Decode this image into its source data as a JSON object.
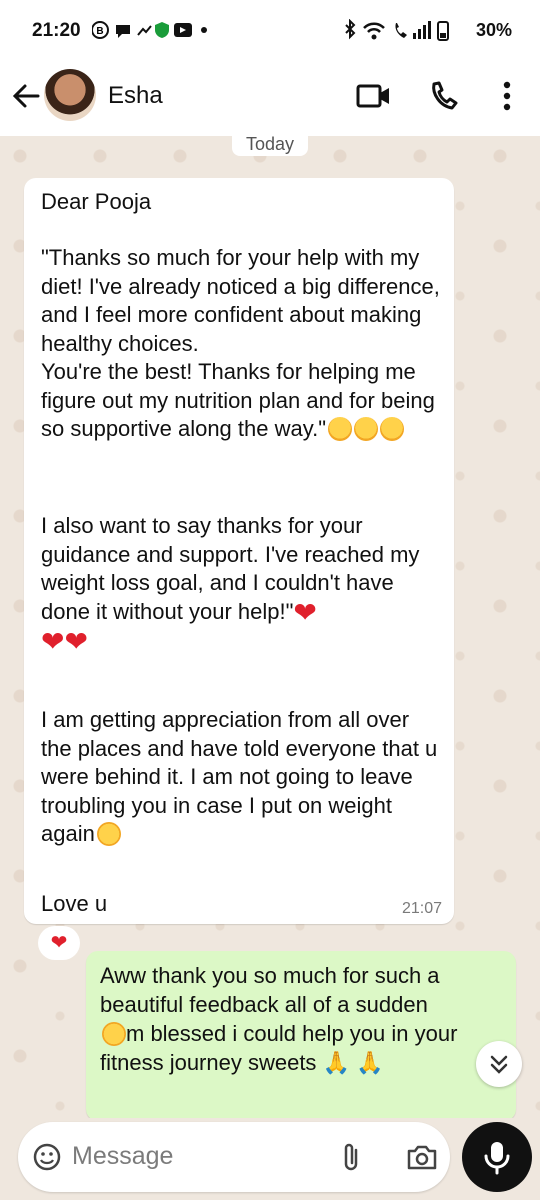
{
  "status_bar": {
    "time": "21:20",
    "battery": "30%"
  },
  "header": {
    "contact_name": "Esha"
  },
  "chat": {
    "day_label": "Today",
    "incoming": {
      "greeting": "Dear Pooja",
      "para1": "\"Thanks so much for your help with my diet! I've already noticed a big difference, and I feel more confident about making healthy choices.\n You're the best! Thanks for helping me figure out my nutrition plan and for being so supportive along the way.\"",
      "para2": "I also  want to say thanks for your guidance and support. I've reached my weight loss goal, and I couldn't have done it without your help!\"",
      "para3": "I am getting appreciation from all over the places and have told everyone that u were behind it. I am not going to leave troubling you in case I put on weight again",
      "closing": "Love u",
      "time": "21:07"
    },
    "outgoing": {
      "line1": "Aww thank you so much for such a beautiful feedback all of a sudden",
      "line2": "m blessed i could help you in your fitness journey sweets"
    }
  },
  "composer": {
    "placeholder": "Message"
  },
  "icons": [
    "back-arrow-icon",
    "video-call-icon",
    "phone-icon",
    "more-options-icon",
    "emoji-icon",
    "attach-icon",
    "camera-icon",
    "mic-icon",
    "scroll-down-icon"
  ]
}
